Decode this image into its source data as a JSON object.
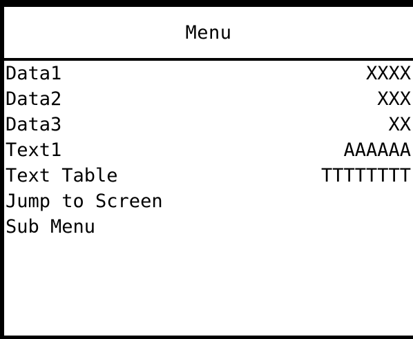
{
  "colors": {
    "background": "#000000",
    "panel": "#ffffff",
    "text": "#000000"
  },
  "header": {
    "title": "Menu"
  },
  "menu": {
    "items": [
      {
        "label": "Data1",
        "value": "XXXX"
      },
      {
        "label": "Data2",
        "value": "XXX"
      },
      {
        "label": "Data3",
        "value": "XX"
      },
      {
        "label": "Text1",
        "value": "AAAAAA"
      },
      {
        "label": "Text Table",
        "value": "TTTTTTTT"
      },
      {
        "label": "Jump to Screen",
        "value": ""
      },
      {
        "label": "Sub Menu",
        "value": ""
      }
    ]
  }
}
